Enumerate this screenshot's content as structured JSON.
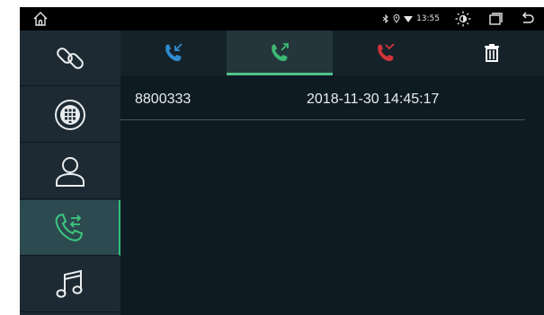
{
  "status_bar": {
    "time": "13:55",
    "icons": [
      "home-icon",
      "bluetooth-icon",
      "location-icon",
      "wifi-icon",
      "brightness-icon",
      "recent-apps-icon",
      "back-icon"
    ]
  },
  "sidebar": {
    "items": [
      {
        "name": "link",
        "icon": "link-icon",
        "active": false
      },
      {
        "name": "dialpad",
        "icon": "dialpad-icon",
        "active": false
      },
      {
        "name": "contacts",
        "icon": "contact-icon",
        "active": false
      },
      {
        "name": "call-history",
        "icon": "call-transfer-icon",
        "active": true
      },
      {
        "name": "music",
        "icon": "music-icon",
        "active": false
      }
    ]
  },
  "tabs": [
    {
      "name": "incoming",
      "icon": "incoming-call-icon",
      "color": "#2f8bd0",
      "active": false
    },
    {
      "name": "outgoing",
      "icon": "outgoing-call-icon",
      "color": "#3cb872",
      "active": true
    },
    {
      "name": "missed",
      "icon": "missed-call-icon",
      "color": "#d0333b",
      "active": false
    },
    {
      "name": "delete",
      "icon": "trash-icon",
      "color": "#ffffff",
      "active": false
    }
  ],
  "calls": [
    {
      "number": "8800333",
      "datetime": "2018-11-30 14:45:17"
    }
  ],
  "colors": {
    "accent": "#4fc28a",
    "sidebar_active": "#2c4a4f",
    "background": "#0f1b22"
  }
}
